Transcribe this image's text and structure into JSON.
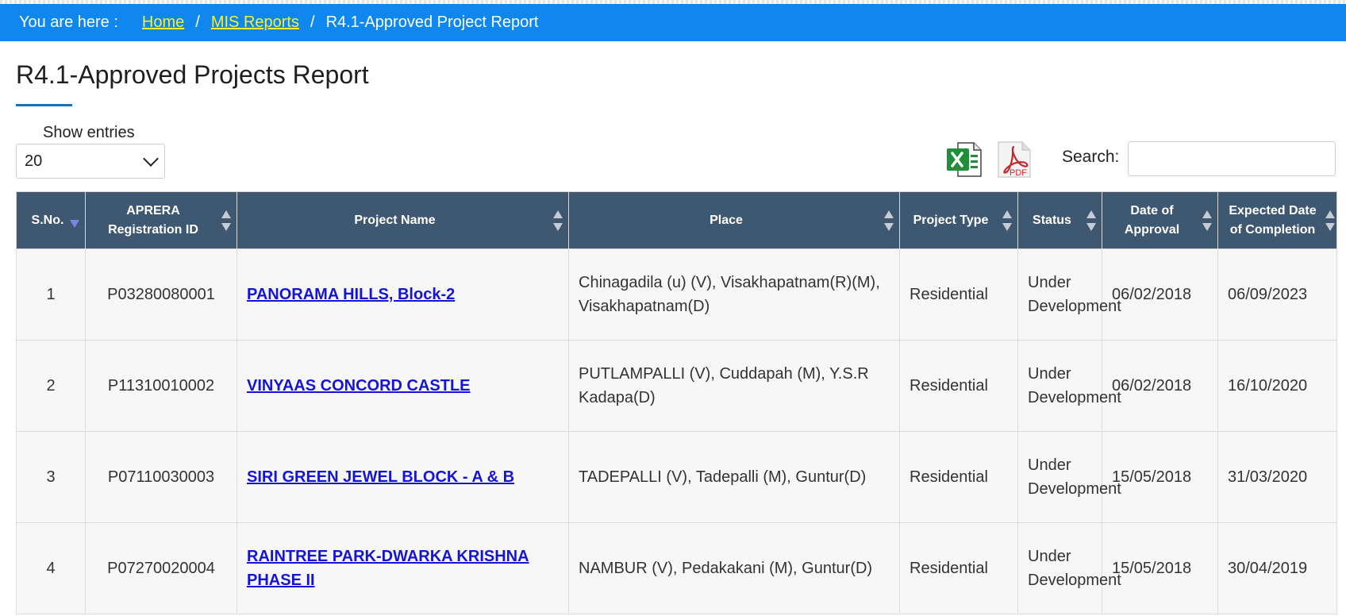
{
  "breadcrumb": {
    "prefix": "You are here :",
    "home": "Home",
    "mis": "MIS Reports",
    "current": "R4.1-Approved Project Report"
  },
  "page_title": "R4.1-Approved Projects Report",
  "entries": {
    "label": "Show entries",
    "value": "20"
  },
  "search": {
    "label": "Search:",
    "value": ""
  },
  "icons": {
    "excel": "excel-export-icon",
    "pdf": "pdf-export-icon"
  },
  "colors": {
    "breadcrumb_bg": "#0f87ee",
    "link_yellow": "#f5ef3a",
    "header_bg": "#3f5872",
    "link_blue": "#1414d8"
  },
  "columns": {
    "sno": "S.No.",
    "reg_line1": "APRERA",
    "reg_line2": "Registration ID",
    "name": "Project Name",
    "place": "Place",
    "type": "Project Type",
    "status": "Status",
    "approval_line1": "Date of",
    "approval_line2": "Approval",
    "completion_line1": "Expected Date",
    "completion_line2": "of Completion"
  },
  "rows": [
    {
      "sno": "1",
      "reg_id": "P03280080001",
      "name": "PANORAMA HILLS, Block-2",
      "place": "Chinagadila (u) (V), Visakhapatnam(R)(M), Visakhapatnam(D)",
      "type": "Residential",
      "status": "Under Development",
      "approval": "06/02/2018",
      "completion": "06/09/2023"
    },
    {
      "sno": "2",
      "reg_id": "P11310010002",
      "name": "VINYAAS CONCORD CASTLE",
      "place": "PUTLAMPALLI (V), Cuddapah (M), Y.S.R Kadapa(D)",
      "type": "Residential",
      "status": "Under Development",
      "approval": "06/02/2018",
      "completion": "16/10/2020"
    },
    {
      "sno": "3",
      "reg_id": "P07110030003",
      "name": "SIRI GREEN JEWEL BLOCK - A & B",
      "place": "TADEPALLI (V), Tadepalli (M), Guntur(D)",
      "type": "Residential",
      "status": "Under Development",
      "approval": "15/05/2018",
      "completion": "31/03/2020"
    },
    {
      "sno": "4",
      "reg_id": "P07270020004",
      "name": "RAINTREE PARK-DWARKA KRISHNA PHASE II",
      "place": "NAMBUR (V), Pedakakani (M), Guntur(D)",
      "type": "Residential",
      "status": "Under Development",
      "approval": "15/05/2018",
      "completion": "30/04/2019"
    }
  ]
}
